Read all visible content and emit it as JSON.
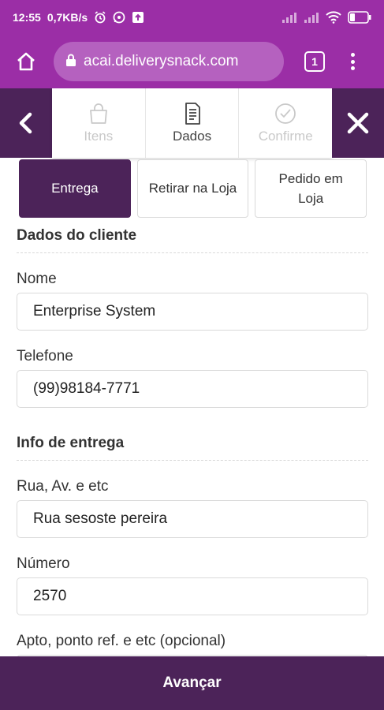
{
  "status_bar": {
    "time": "12:55",
    "speed": "0,7KB/s",
    "battery": "22"
  },
  "browser": {
    "url": "acai.deliverysnack.com",
    "tab_count": "1"
  },
  "steps": [
    {
      "label": "Itens",
      "state": "inactive"
    },
    {
      "label": "Dados",
      "state": "active"
    },
    {
      "label": "Confirme",
      "state": "inactive"
    }
  ],
  "delivery_options": [
    {
      "label": "Entrega",
      "selected": true
    },
    {
      "label": "Retirar na Loja",
      "selected": false
    },
    {
      "label": "Pedido em Loja",
      "selected": false
    }
  ],
  "form": {
    "client_section_title": "Dados do cliente",
    "name": {
      "label": "Nome",
      "value": "Enterprise System"
    },
    "phone": {
      "label": "Telefone",
      "value": "(99)98184-7771"
    },
    "delivery_section_title": "Info de entrega",
    "street": {
      "label": "Rua, Av. e etc",
      "value": "Rua sesoste pereira"
    },
    "number": {
      "label": "Número",
      "value": "2570"
    },
    "complement": {
      "label": "Apto, ponto ref. e etc (opcional)",
      "value": ""
    }
  },
  "footer": {
    "next_label": "Avançar"
  },
  "colors": {
    "browser_bar": "#9b2ea6",
    "primary": "#4c2359"
  }
}
